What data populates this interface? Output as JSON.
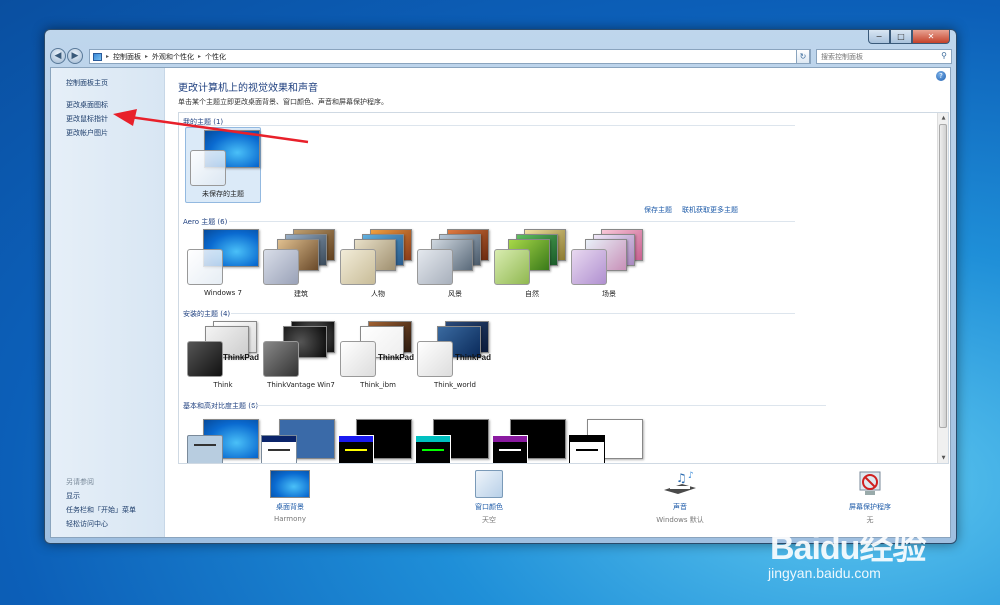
{
  "window": {
    "min": "−",
    "max": "□",
    "close": "✕"
  },
  "nav": {
    "back": "◀",
    "forward": "▶"
  },
  "breadcrumb": [
    "控制面板",
    "外观和个性化",
    "个性化"
  ],
  "search": {
    "placeholder": "搜索控制面板"
  },
  "sidebar": {
    "home": "控制面板主页",
    "links": [
      "更改桌面图标",
      "更改鼠标指针",
      "更改帐户图片"
    ],
    "see_also": "另请参阅",
    "see_also_links": [
      "显示",
      "任务栏和「开始」菜单",
      "轻松访问中心"
    ]
  },
  "main": {
    "heading": "更改计算机上的视觉效果和声音",
    "subheading": "单击某个主题立即更改桌面背景、窗口颜色、声音和屏幕保护程序。",
    "my_themes": {
      "title": "我的主题 (1)",
      "items": [
        {
          "label": "未保存的主题"
        }
      ],
      "save": "保存主题",
      "online": "联机获取更多主题"
    },
    "aero": {
      "title": "Aero 主题 (6)",
      "items": [
        {
          "label": "Windows 7"
        },
        {
          "label": "建筑"
        },
        {
          "label": "人物"
        },
        {
          "label": "风景"
        },
        {
          "label": "自然"
        },
        {
          "label": "场景"
        }
      ]
    },
    "installed": {
      "title": "安装的主题 (4)",
      "brand": "ThinkPad",
      "items": [
        {
          "label": "Think"
        },
        {
          "label": "ThinkVantage Win7"
        },
        {
          "label": "Think_ibm"
        },
        {
          "label": "Think_world"
        }
      ]
    },
    "basic": {
      "title": "基本和高对比度主题 (6)"
    }
  },
  "bottom": {
    "desktop": {
      "label": "桌面背景",
      "sub": "Harmony"
    },
    "color": {
      "label": "窗口颜色",
      "sub": "天空"
    },
    "sound": {
      "label": "声音",
      "sub": "Windows 默认"
    },
    "screensaver": {
      "label": "屏幕保护程序",
      "sub": "无"
    }
  },
  "watermark": {
    "brand": "Baidu经验",
    "url": "jingyan.baidu.com"
  },
  "colors": {
    "accent": "#1e3f7f",
    "link": "#1c5aa8",
    "arrow": "#e8202a"
  }
}
